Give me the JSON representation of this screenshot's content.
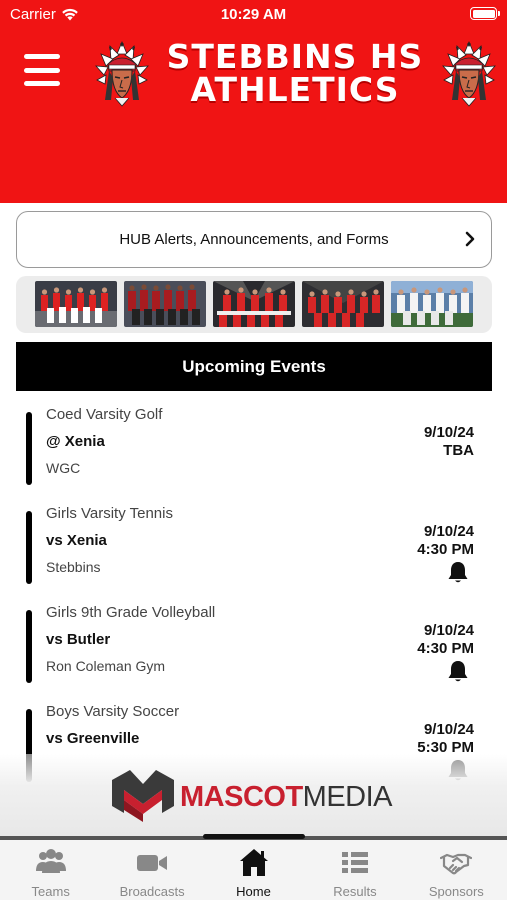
{
  "status_bar": {
    "carrier": "Carrier",
    "time": "10:29 AM"
  },
  "header": {
    "title_line1": "STEBBINS HS",
    "title_line2": "ATHLETICS",
    "background_color": "#f01414",
    "left_logo_icon": "chief-headdress-logo-icon",
    "right_logo_icon": "chief-headdress-logo-icon",
    "menu_icon": "hamburger-menu-icon"
  },
  "hub": {
    "label": "HUB Alerts, Announcements, and Forms",
    "icon": "chevron-right-icon"
  },
  "photos": [
    {
      "name": "team-photo-1"
    },
    {
      "name": "team-photo-2"
    },
    {
      "name": "team-photo-3"
    },
    {
      "name": "team-photo-4"
    },
    {
      "name": "team-photo-5"
    }
  ],
  "events_header": "Upcoming Events",
  "events": [
    {
      "sport": "Coed Varsity Golf",
      "opponent": "@ Xenia",
      "location": "WGC",
      "date": "9/10/24",
      "time": "TBA",
      "has_bell": false
    },
    {
      "sport": "Girls Varsity Tennis",
      "opponent": "vs Xenia",
      "location": "Stebbins",
      "date": "9/10/24",
      "time": "4:30 PM",
      "has_bell": true
    },
    {
      "sport": "Girls 9th Grade Volleyball",
      "opponent": "vs Butler",
      "location": "Ron Coleman Gym",
      "date": "9/10/24",
      "time": "4:30 PM",
      "has_bell": true
    },
    {
      "sport": "Boys Varsity Soccer",
      "opponent": "vs Greenville",
      "location": "",
      "date": "9/10/24",
      "time": "5:30 PM",
      "has_bell": true
    }
  ],
  "sponsor": {
    "word1": "MASCOT",
    "word2": "MEDIA",
    "mark_icon": "mascot-media-m-logo-icon"
  },
  "tabs": [
    {
      "label": "Teams",
      "icon": "people-icon",
      "active": false
    },
    {
      "label": "Broadcasts",
      "icon": "video-camera-icon",
      "active": false
    },
    {
      "label": "Home",
      "icon": "home-icon",
      "active": true
    },
    {
      "label": "Results",
      "icon": "list-icon",
      "active": false
    },
    {
      "label": "Sponsors",
      "icon": "handshake-icon",
      "active": false
    }
  ],
  "colors": {
    "accent_red": "#f01414",
    "black": "#000000",
    "sponsor_red": "#c8202f"
  }
}
